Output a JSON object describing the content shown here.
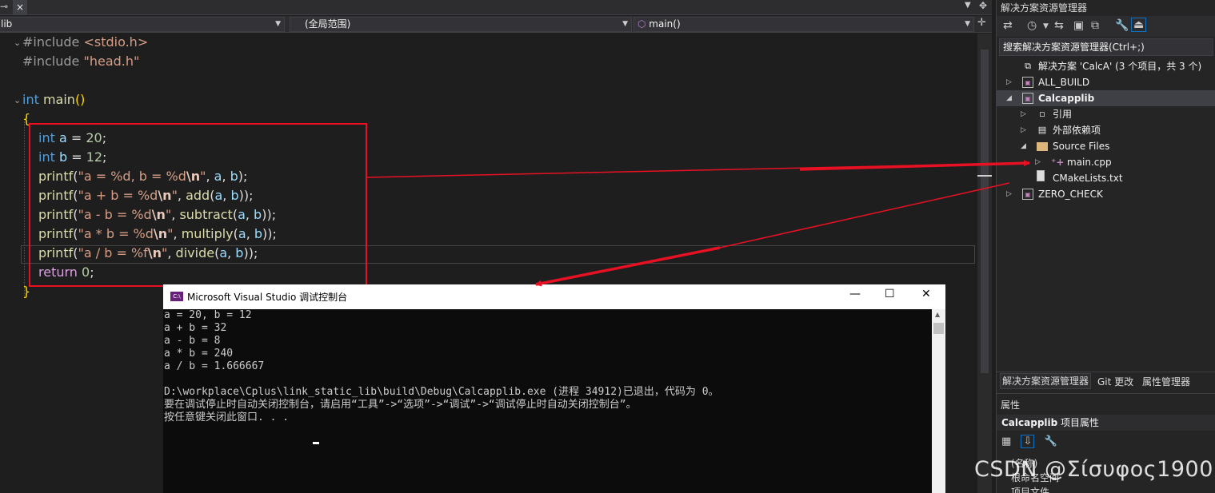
{
  "editor": {
    "tab_close": "×",
    "nav": {
      "project": "lib",
      "scope": "(全局范围)",
      "member": "main()"
    },
    "code_lines": [
      {
        "tokens": [
          [
            "pp",
            "#include "
          ],
          [
            "str",
            "<stdio.h>"
          ]
        ]
      },
      {
        "tokens": [
          [
            "pp",
            "#include "
          ],
          [
            "str",
            "\"head.h\""
          ]
        ]
      },
      {
        "tokens": []
      },
      {
        "tokens": [
          [
            "kw",
            "int "
          ],
          [
            "fn",
            "main"
          ],
          [
            "brace",
            "()"
          ]
        ]
      },
      {
        "tokens": [
          [
            "brace",
            "{"
          ]
        ]
      },
      {
        "tokens": [
          [
            "kw",
            "int "
          ],
          [
            "var",
            "a"
          ],
          [
            "",
            " = "
          ],
          [
            "num",
            "20"
          ],
          [
            "",
            ";"
          ]
        ],
        "indent": true
      },
      {
        "tokens": [
          [
            "kw",
            "int "
          ],
          [
            "var",
            "b"
          ],
          [
            "",
            " = "
          ],
          [
            "num",
            "12"
          ],
          [
            "",
            ";"
          ]
        ],
        "indent": true
      },
      {
        "tokens": [
          [
            "fn",
            "printf"
          ],
          [
            "",
            "("
          ],
          [
            "str",
            "\"a = %d, b = %d"
          ],
          [
            "esc",
            "\\n"
          ],
          [
            "str",
            "\""
          ],
          [
            "",
            ", "
          ],
          [
            "var",
            "a"
          ],
          [
            "",
            ", "
          ],
          [
            "var",
            "b"
          ],
          [
            "",
            ");"
          ]
        ],
        "indent": true
      },
      {
        "tokens": [
          [
            "fn",
            "printf"
          ],
          [
            "",
            "("
          ],
          [
            "str",
            "\"a + b = %d"
          ],
          [
            "esc",
            "\\n"
          ],
          [
            "str",
            "\""
          ],
          [
            "",
            ", "
          ],
          [
            "fn",
            "add"
          ],
          [
            "",
            "("
          ],
          [
            "var",
            "a"
          ],
          [
            "",
            ", "
          ],
          [
            "var",
            "b"
          ],
          [
            "",
            "));"
          ]
        ],
        "indent": true
      },
      {
        "tokens": [
          [
            "fn",
            "printf"
          ],
          [
            "",
            "("
          ],
          [
            "str",
            "\"a - b = %d"
          ],
          [
            "esc",
            "\\n"
          ],
          [
            "str",
            "\""
          ],
          [
            "",
            ", "
          ],
          [
            "fn",
            "subtract"
          ],
          [
            "",
            "("
          ],
          [
            "var",
            "a"
          ],
          [
            "",
            ", "
          ],
          [
            "var",
            "b"
          ],
          [
            "",
            "));"
          ]
        ],
        "indent": true
      },
      {
        "tokens": [
          [
            "fn",
            "printf"
          ],
          [
            "",
            "("
          ],
          [
            "str",
            "\"a * b = %d"
          ],
          [
            "esc",
            "\\n"
          ],
          [
            "str",
            "\""
          ],
          [
            "",
            ", "
          ],
          [
            "fn",
            "multiply"
          ],
          [
            "",
            "("
          ],
          [
            "var",
            "a"
          ],
          [
            "",
            ", "
          ],
          [
            "var",
            "b"
          ],
          [
            "",
            "));"
          ]
        ],
        "indent": true
      },
      {
        "tokens": [
          [
            "fn",
            "printf"
          ],
          [
            "",
            "("
          ],
          [
            "str",
            "\"a / b = %f"
          ],
          [
            "esc",
            "\\n"
          ],
          [
            "str",
            "\""
          ],
          [
            "",
            ", "
          ],
          [
            "fn",
            "divide"
          ],
          [
            "",
            "("
          ],
          [
            "var",
            "a"
          ],
          [
            "",
            ", "
          ],
          [
            "var",
            "b"
          ],
          [
            "",
            "));"
          ]
        ],
        "indent": true
      },
      {
        "tokens": [
          [
            "kw2",
            "return "
          ],
          [
            "num",
            "0"
          ],
          [
            "",
            ";"
          ]
        ],
        "indent": true
      },
      {
        "tokens": [
          [
            "brace",
            "}"
          ]
        ]
      }
    ]
  },
  "solution_explorer": {
    "title": "解决方案资源管理器",
    "search_placeholder": "搜索解决方案资源管理器(Ctrl+;)",
    "items": [
      {
        "label": "解决方案 'CalcA' (3 个项目，共 3 个)",
        "level": 0,
        "kind": "solution",
        "expander": ""
      },
      {
        "label": "ALL_BUILD",
        "level": 0,
        "kind": "project",
        "expander": "▷"
      },
      {
        "label": "Calcapplib",
        "level": 0,
        "kind": "project",
        "expander": "◢",
        "bold": true,
        "selected": true
      },
      {
        "label": "引用",
        "level": 1,
        "kind": "ref",
        "expander": "▷"
      },
      {
        "label": "外部依赖项",
        "level": 1,
        "kind": "ext",
        "expander": "▷"
      },
      {
        "label": "Source Files",
        "level": 1,
        "kind": "folder",
        "expander": "◢"
      },
      {
        "label": "main.cpp",
        "level": 2,
        "kind": "cpp",
        "expander": "▷"
      },
      {
        "label": "CMakeLists.txt",
        "level": 1,
        "kind": "file",
        "expander": ""
      },
      {
        "label": "ZERO_CHECK",
        "level": 0,
        "kind": "project",
        "expander": "▷"
      }
    ],
    "bottom_tabs": [
      "解决方案资源管理器",
      "Git 更改",
      "属性管理器"
    ]
  },
  "properties": {
    "title": "属性",
    "subject_name": "Calcapplib",
    "subject_suffix": " 项目属性",
    "rows": [
      "(名称)",
      "根命名空间",
      "项目文件"
    ]
  },
  "console": {
    "title": "Microsoft Visual Studio 调试控制台",
    "icon_text": "C:\\",
    "lines": [
      "a = 20, b = 12",
      "a + b = 32",
      "a - b = 8",
      "a * b = 240",
      "a / b = 1.666667",
      "",
      "D:\\workplace\\Cplus\\link_static_lib\\build\\Debug\\Calcapplib.exe (进程 34912)已退出，代码为 0。",
      "要在调试停止时自动关闭控制台，请启用“工具”->“选项”->“调试”->“调试停止时自动关闭控制台”。",
      "按任意键关闭此窗口. . ."
    ],
    "minimize": "—",
    "maximize": "☐",
    "close": "✕"
  },
  "watermark": "CSDN @Σίσυφος1900",
  "colors": {
    "annotation_red": "#e81123"
  }
}
